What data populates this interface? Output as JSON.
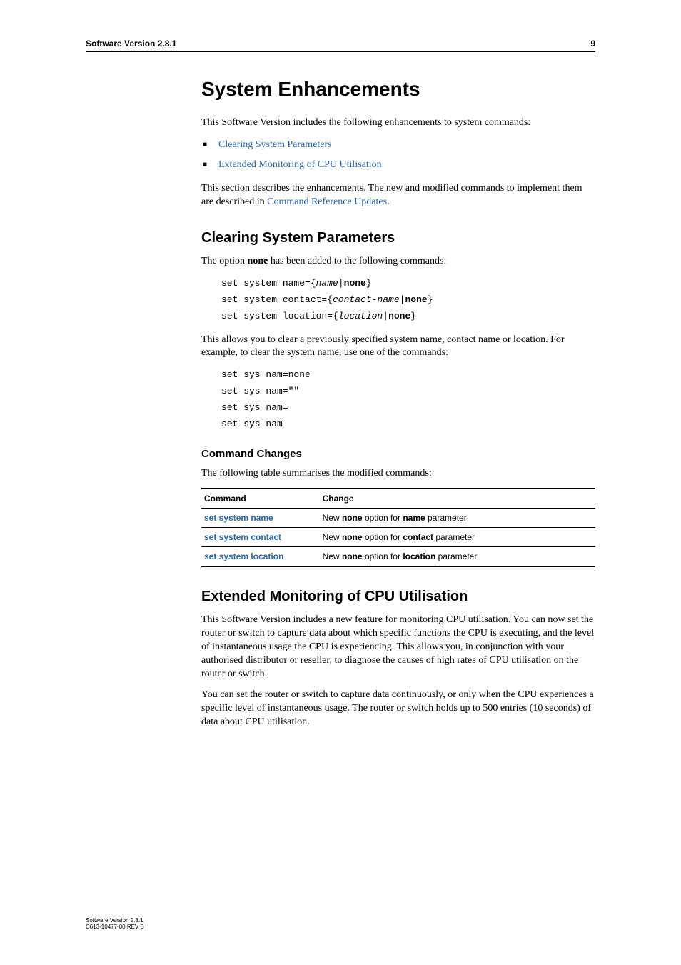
{
  "header": {
    "title": "Software Version 2.8.1",
    "page": "9"
  },
  "h1": "System Enhancements",
  "intro": "This Software Version includes the following enhancements to system commands:",
  "bullets": [
    "Clearing System Parameters",
    "Extended Monitoring of CPU Utilisation"
  ],
  "section_desc_before": "This section describes the enhancements. The new and modified commands to implement them are described in ",
  "section_desc_link": "Command Reference Updates",
  "section_desc_after": ".",
  "clearing": {
    "heading": "Clearing System Parameters",
    "p1_before": "The option ",
    "p1_bold": "none",
    "p1_after": " has been added to the following commands:",
    "code1": {
      "l1_a": "set system name={",
      "l1_i": "name",
      "l1_b": "|",
      "l1_bold": "none",
      "l1_c": "}",
      "l2_a": "set system contact={",
      "l2_i": "contact-name",
      "l2_b": "|",
      "l2_bold": "none",
      "l2_c": "}",
      "l3_a": "set system location={",
      "l3_i": "location",
      "l3_b": "|",
      "l3_bold": "none",
      "l3_c": "}"
    },
    "p2": "This allows you to clear a previously specified system name, contact name or location. For example, to clear the system name, use one of the commands:",
    "code2": {
      "l1": "set sys nam=none",
      "l2": "set sys nam=\"\"",
      "l3": "set sys nam=",
      "l4": "set sys nam"
    },
    "changes": {
      "heading": "Command Changes",
      "p": "The following table summarises the modified commands:",
      "th1": "Command",
      "th2": "Change",
      "rows": [
        {
          "cmd": "set system name",
          "ch_a": "New ",
          "ch_b1": "none",
          "ch_b": " option for ",
          "ch_b2": "name",
          "ch_c": " parameter"
        },
        {
          "cmd": "set system contact",
          "ch_a": "New ",
          "ch_b1": "none",
          "ch_b": " option for ",
          "ch_b2": "contact",
          "ch_c": " parameter"
        },
        {
          "cmd": "set system location",
          "ch_a": "New ",
          "ch_b1": "none",
          "ch_b": " option for ",
          "ch_b2": "location",
          "ch_c": " parameter"
        }
      ]
    }
  },
  "extended": {
    "heading": "Extended Monitoring of CPU Utilisation",
    "p1": "This Software Version includes a new feature for monitoring CPU utilisation. You can now set the router or switch to capture data about which specific functions the CPU is executing, and the level of instantaneous usage the CPU is experiencing. This allows you, in conjunction with your authorised distributor or reseller, to diagnose the causes of high rates of CPU utilisation on the router or switch.",
    "p2": "You can set the router or switch to capture data continuously, or only when the CPU experiences a specific level of instantaneous usage. The router or switch holds up to 500 entries (10 seconds) of data about CPU utilisation."
  },
  "footer": {
    "l1": "Software Version 2.8.1",
    "l2": "C613-10477-00 REV B"
  }
}
